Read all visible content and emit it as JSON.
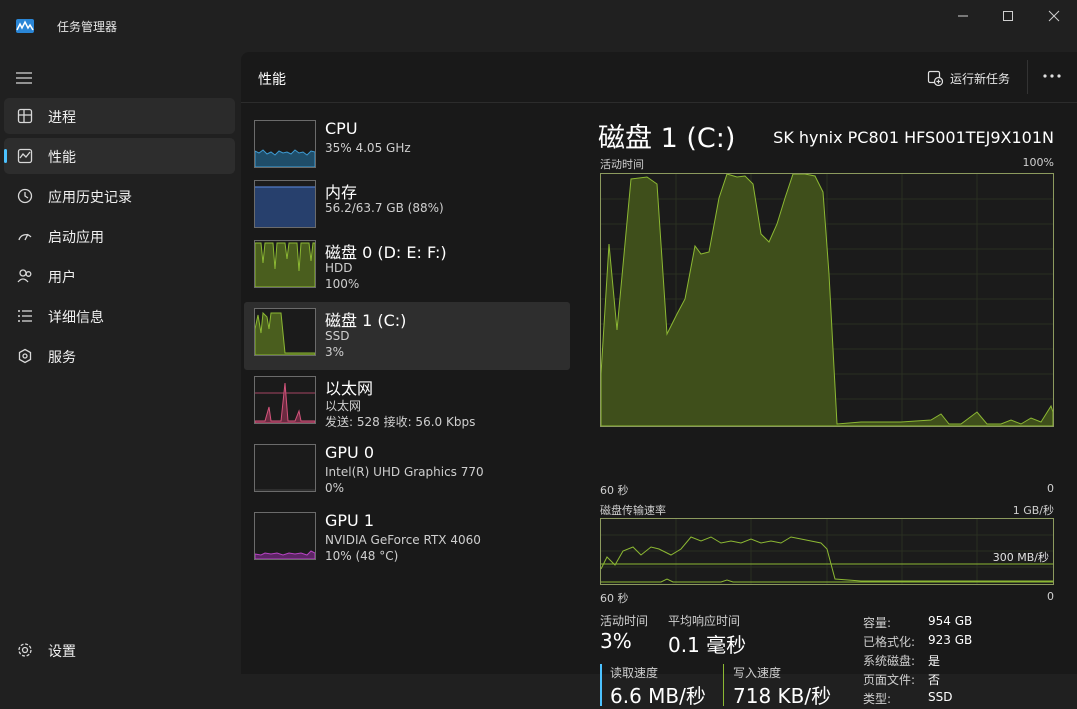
{
  "window": {
    "title": "任务管理器"
  },
  "sidebar": {
    "items": [
      {
        "label": "进程",
        "icon": "processes-icon"
      },
      {
        "label": "性能",
        "icon": "performance-icon"
      },
      {
        "label": "应用历史记录",
        "icon": "app-history-icon"
      },
      {
        "label": "启动应用",
        "icon": "startup-apps-icon"
      },
      {
        "label": "用户",
        "icon": "users-icon"
      },
      {
        "label": "详细信息",
        "icon": "details-icon"
      },
      {
        "label": "服务",
        "icon": "services-icon"
      }
    ],
    "selected": "性能",
    "settings_label": "设置"
  },
  "header": {
    "title": "性能",
    "run_task_label": "运行新任务"
  },
  "devices": [
    {
      "name": "CPU",
      "line1": "35%  4.05 GHz",
      "line2": ""
    },
    {
      "name": "内存",
      "line1": "56.2/63.7 GB (88%)",
      "line2": ""
    },
    {
      "name": "磁盘 0 (D: E: F:)",
      "line1": "HDD",
      "line2": "100%"
    },
    {
      "name": "磁盘 1 (C:)",
      "line1": "SSD",
      "line2": "3%"
    },
    {
      "name": "以太网",
      "line1": "以太网",
      "line2": "发送: 528  接收: 56.0 Kbps"
    },
    {
      "name": "GPU 0",
      "line1": "Intel(R) UHD Graphics 770",
      "line2": "0%"
    },
    {
      "name": "GPU 1",
      "line1": "NVIDIA GeForce RTX 4060",
      "line2": "10%  (48 °C)"
    }
  ],
  "selected_device": "磁盘 1 (C:)",
  "detail": {
    "title": "磁盘 1 (C:)",
    "model": "SK hynix PC801 HFS001TEJ9X101N",
    "active_time_graph": {
      "label": "活动时间",
      "max": "100%",
      "x_left": "60 秒",
      "x_right": "0"
    },
    "transfer_graph": {
      "label": "磁盘传输速率",
      "max": "1 GB/秒",
      "marker": "300 MB/秒",
      "x_left": "60 秒",
      "x_right": "0"
    },
    "stats": {
      "active_time_label": "活动时间",
      "active_time": "3%",
      "avg_response_label": "平均响应时间",
      "avg_response": "0.1 毫秒",
      "read_label": "读取速度",
      "read": "6.6 MB/秒",
      "write_label": "写入速度",
      "write": "718 KB/秒"
    },
    "properties": [
      {
        "k": "容量:",
        "v": "954 GB"
      },
      {
        "k": "已格式化:",
        "v": "923 GB"
      },
      {
        "k": "系统磁盘:",
        "v": "是"
      },
      {
        "k": "页面文件:",
        "v": "否"
      },
      {
        "k": "类型:",
        "v": "SSD"
      }
    ]
  },
  "colors": {
    "disk": "#8cb833",
    "cpu": "#3d9ad1",
    "memory": "#4f79c6",
    "ethernet": "#d4547c",
    "gpu": "#b744c4",
    "read_bar": "#4cc2ff",
    "write_bar": "#8cb833"
  }
}
